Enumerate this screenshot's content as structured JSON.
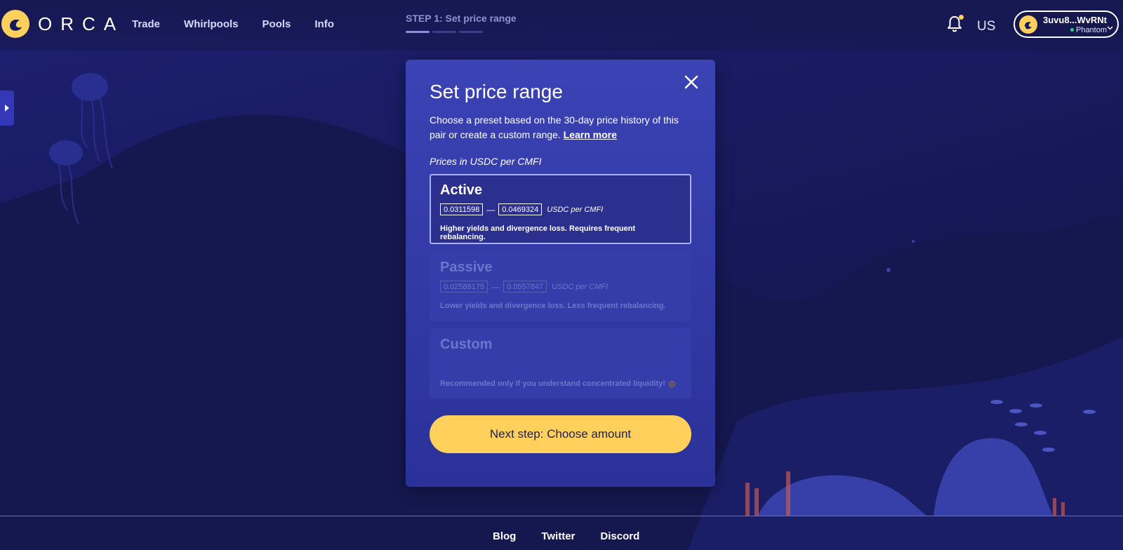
{
  "header": {
    "brand": "ORCA",
    "nav": [
      "Trade",
      "Whirlpools",
      "Pools",
      "Info"
    ],
    "step_label": "STEP 1: Set price range",
    "step_total": 3,
    "step_current": 1,
    "region": "US",
    "wallet_address": "3uvu8...WvRNt",
    "wallet_provider": "Phantom"
  },
  "modal": {
    "title": "Set price range",
    "description": "Choose a preset based on the 30-day price history of this pair or create a custom range.",
    "learn_more": "Learn more",
    "price_unit_label": "Prices in USDC per CMFI",
    "options": [
      {
        "title": "Active",
        "min": "0.0311598",
        "max": "0.0469324",
        "unit": "USDC per CMFI",
        "note": "Higher yields and divergence loss. Requires frequent rebalancing.",
        "selected": true
      },
      {
        "title": "Passive",
        "min": "0.02588175",
        "max": "0.0557847",
        "unit": "USDC per CMFI",
        "note": "Lower yields and divergence loss. Less frequent rebalancing.",
        "selected": false
      },
      {
        "title": "Custom",
        "note": "Recommended only if you understand concentrated liquidity!",
        "selected": false
      }
    ],
    "next_button": "Next step: Choose amount"
  },
  "footer": {
    "links": [
      "Blog",
      "Twitter",
      "Discord"
    ]
  },
  "colors": {
    "background": "#16195a",
    "modal": "#3b43b5",
    "accent": "#ffd15c"
  }
}
